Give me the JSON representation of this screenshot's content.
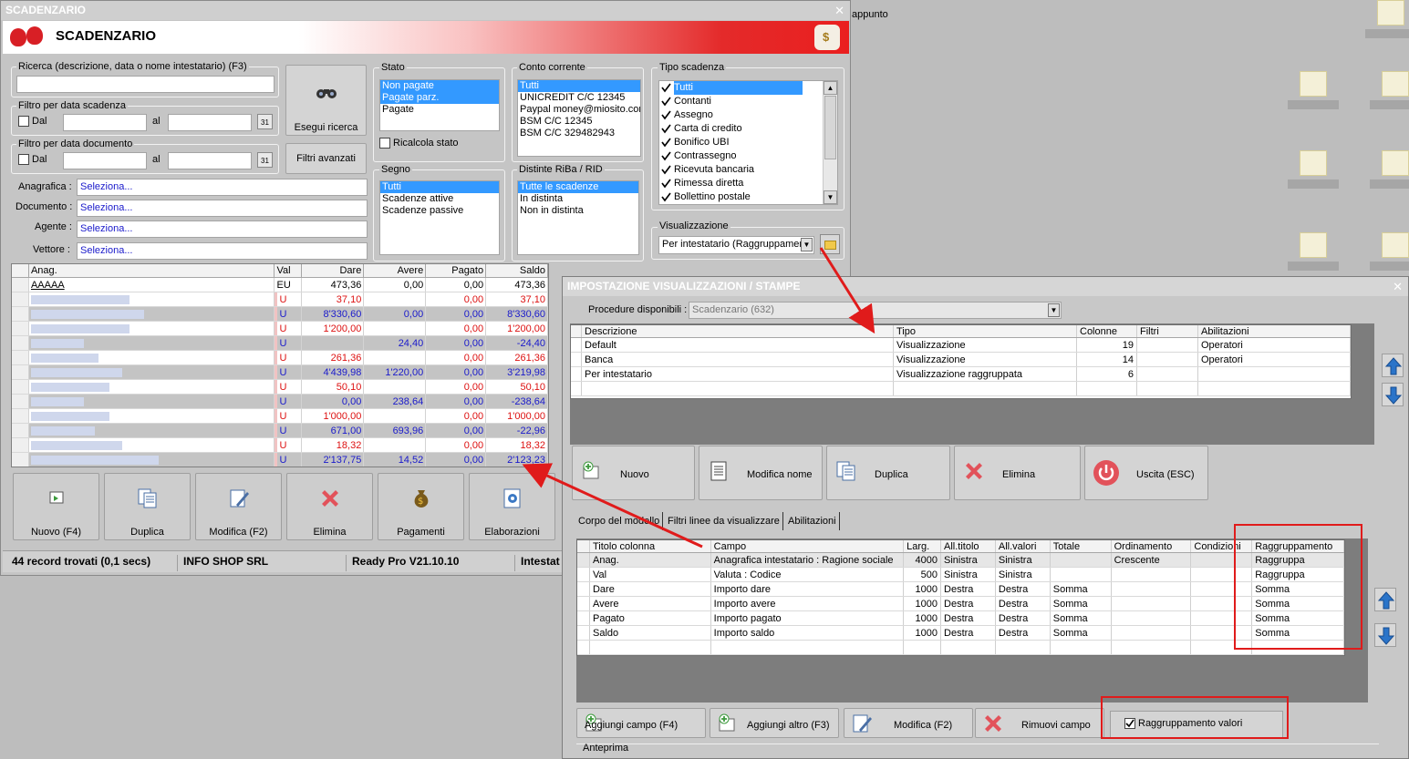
{
  "desktop": {
    "icon_label": "appunto"
  },
  "main": {
    "window_title": "SCADENZARIO",
    "banner_title": "SCADENZARIO",
    "search": {
      "label": "Ricerca (descrizione, data o nome intestatario) (F3)",
      "value": "",
      "run_button": "Esegui ricerca",
      "advanced_button": "Filtri avanzati"
    },
    "filter_due": {
      "label": "Filtro per data scadenza",
      "from_label": "Dal",
      "to_label": "al"
    },
    "filter_doc": {
      "label": "Filtro per data documento",
      "from_label": "Dal",
      "to_label": "al"
    },
    "lookups": [
      {
        "label": "Anagrafica :",
        "value": "Seleziona..."
      },
      {
        "label": "Documento :",
        "value": "Seleziona..."
      },
      {
        "label": "Agente :",
        "value": "Seleziona..."
      },
      {
        "label": "Vettore :",
        "value": "Seleziona..."
      }
    ],
    "stato": {
      "label": "Stato",
      "items": [
        "Non pagate",
        "Pagate parz.",
        "Pagate"
      ],
      "recalc_label": "Ricalcola stato"
    },
    "conto": {
      "label": "Conto corrente",
      "items": [
        "Tutti",
        "UNICREDIT C/C 12345",
        "Paypal money@miosito.com",
        "BSM C/C 12345",
        "BSM C/C 329482943"
      ]
    },
    "tipo": {
      "label": "Tipo scadenza",
      "items": [
        "Tutti",
        "Contanti",
        "Assegno",
        "Carta di credito",
        "Bonifico UBI",
        "Contrassegno",
        "Ricevuta bancaria",
        "Rimessa diretta",
        "Bollettino postale"
      ]
    },
    "segno": {
      "label": "Segno",
      "items": [
        "Tutti",
        "Scadenze attive",
        "Scadenze passive"
      ]
    },
    "distinte": {
      "label": "Distinte RiBa / RID",
      "items": [
        "Tutte le scadenze",
        "In distinta",
        "Non in distinta"
      ]
    },
    "visualizzazione": {
      "label": "Visualizzazione",
      "value": "Per intestatario (Raggruppamen"
    },
    "grid": {
      "columns": [
        "Anag.",
        "Val",
        "Dare",
        "Avere",
        "Pagato",
        "Saldo"
      ],
      "rows": [
        {
          "anag": "AAAAA",
          "val": "EU",
          "dare": "473,36",
          "avere": "0,00",
          "pagato": "0,00",
          "saldo": "473,36"
        },
        {
          "anag": "",
          "val": "U",
          "dare": "37,10",
          "avere": "",
          "pagato": "0,00",
          "saldo": "37,10"
        },
        {
          "anag": "",
          "val": "U",
          "dare": "8'330,60",
          "avere": "0,00",
          "pagato": "0,00",
          "saldo": "8'330,60"
        },
        {
          "anag": "",
          "val": "U",
          "dare": "1'200,00",
          "avere": "",
          "pagato": "0,00",
          "saldo": "1'200,00"
        },
        {
          "anag": "",
          "val": "U",
          "dare": "",
          "avere": "24,40",
          "pagato": "0,00",
          "saldo": "-24,40"
        },
        {
          "anag": "",
          "val": "U",
          "dare": "261,36",
          "avere": "",
          "pagato": "0,00",
          "saldo": "261,36"
        },
        {
          "anag": "",
          "val": "U",
          "dare": "4'439,98",
          "avere": "1'220,00",
          "pagato": "0,00",
          "saldo": "3'219,98"
        },
        {
          "anag": "",
          "val": "U",
          "dare": "50,10",
          "avere": "",
          "pagato": "0,00",
          "saldo": "50,10"
        },
        {
          "anag": "",
          "val": "U",
          "dare": "0,00",
          "avere": "238,64",
          "pagato": "0,00",
          "saldo": "-238,64"
        },
        {
          "anag": "",
          "val": "U",
          "dare": "1'000,00",
          "avere": "",
          "pagato": "0,00",
          "saldo": "1'000,00"
        },
        {
          "anag": "",
          "val": "U",
          "dare": "671,00",
          "avere": "693,96",
          "pagato": "0,00",
          "saldo": "-22,96"
        },
        {
          "anag": "",
          "val": "U",
          "dare": "18,32",
          "avere": "",
          "pagato": "0,00",
          "saldo": "18,32"
        },
        {
          "anag": "",
          "val": "U",
          "dare": "2'137,75",
          "avere": "14,52",
          "pagato": "0,00",
          "saldo": "2'123,23"
        }
      ]
    },
    "toolbar": [
      {
        "label": "Nuovo (F4)",
        "icon": "new-doc-icon"
      },
      {
        "label": "Duplica",
        "icon": "duplicate-icon"
      },
      {
        "label": "Modifica (F2)",
        "icon": "edit-icon"
      },
      {
        "label": "Elimina",
        "icon": "delete-icon"
      },
      {
        "label": "Pagamenti",
        "icon": "money-bag-icon"
      },
      {
        "label": "Elaborazioni",
        "icon": "gear-doc-icon"
      }
    ],
    "status": {
      "records": "44 record trovati (0,1 secs)",
      "company": "INFO SHOP SRL",
      "version": "Ready Pro V21.10.10",
      "extra": "Intestat"
    }
  },
  "dialog": {
    "title": "IMPOSTAZIONE VISUALIZZAZIONI / STAMPE",
    "procedure_label": "Procedure disponibili :",
    "procedure_value": "Scadenzario (632)",
    "views": {
      "columns": [
        "Descrizione",
        "Tipo",
        "Colonne",
        "Filtri",
        "Abilitazioni"
      ],
      "rows": [
        {
          "desc": "Default",
          "tipo": "Visualizzazione",
          "col": "19",
          "filtri": "",
          "abil": "Operatori"
        },
        {
          "desc": "Banca",
          "tipo": "Visualizzazione",
          "col": "14",
          "filtri": "",
          "abil": "Operatori"
        },
        {
          "desc": "Per intestatario",
          "tipo": "Visualizzazione raggruppata",
          "col": "6",
          "filtri": "",
          "abil": ""
        }
      ]
    },
    "buttons": [
      {
        "label": "Nuovo",
        "icon": "add-icon"
      },
      {
        "label": "Modifica nome",
        "icon": "document-icon"
      },
      {
        "label": "Duplica",
        "icon": "duplicate-icon"
      },
      {
        "label": "Elimina",
        "icon": "delete-icon"
      },
      {
        "label": "Uscita (ESC)",
        "icon": "power-icon"
      }
    ],
    "tabs": [
      "Corpo del modello",
      "Filtri linee da visualizzare",
      "Abilitazioni"
    ],
    "fields": {
      "columns": [
        "Titolo colonna",
        "Campo",
        "Larg.",
        "All.titolo",
        "All.valori",
        "Totale",
        "Ordinamento",
        "Condizioni",
        "Raggruppamento"
      ],
      "rows": [
        {
          "titolo": "Anag.",
          "campo": "Anagrafica intestatario : Ragione sociale",
          "larg": "4000",
          "allt": "Sinistra",
          "allv": "Sinistra",
          "tot": "",
          "ord": "Crescente",
          "cond": "",
          "ragg": "Raggruppa"
        },
        {
          "titolo": "Val",
          "campo": "Valuta : Codice",
          "larg": "500",
          "allt": "Sinistra",
          "allv": "Sinistra",
          "tot": "",
          "ord": "",
          "cond": "",
          "ragg": "Raggruppa"
        },
        {
          "titolo": "Dare",
          "campo": "Importo dare",
          "larg": "1000",
          "allt": "Destra",
          "allv": "Destra",
          "tot": "Somma",
          "ord": "",
          "cond": "",
          "ragg": "Somma"
        },
        {
          "titolo": "Avere",
          "campo": "Importo avere",
          "larg": "1000",
          "allt": "Destra",
          "allv": "Destra",
          "tot": "Somma",
          "ord": "",
          "cond": "",
          "ragg": "Somma"
        },
        {
          "titolo": "Pagato",
          "campo": "Importo pagato",
          "larg": "1000",
          "allt": "Destra",
          "allv": "Destra",
          "tot": "Somma",
          "ord": "",
          "cond": "",
          "ragg": "Somma"
        },
        {
          "titolo": "Saldo",
          "campo": "Importo saldo",
          "larg": "1000",
          "allt": "Destra",
          "allv": "Destra",
          "tot": "Somma",
          "ord": "",
          "cond": "",
          "ragg": "Somma"
        }
      ]
    },
    "field_buttons": [
      {
        "label": "Aggiungi campo (F4)",
        "icon": "add-icon"
      },
      {
        "label": "Aggiungi altro (F3)",
        "icon": "add-icon"
      },
      {
        "label": "Modifica (F2)",
        "icon": "edit-icon"
      },
      {
        "label": "Rimuovi campo",
        "icon": "delete-icon"
      }
    ],
    "group_values_label": "Raggruppamento valori",
    "preview_label": "Anteprima"
  },
  "colors": {
    "selection": "#3399ff",
    "highlight_red": "#e01b1b",
    "link_blue": "#1a1acb"
  }
}
